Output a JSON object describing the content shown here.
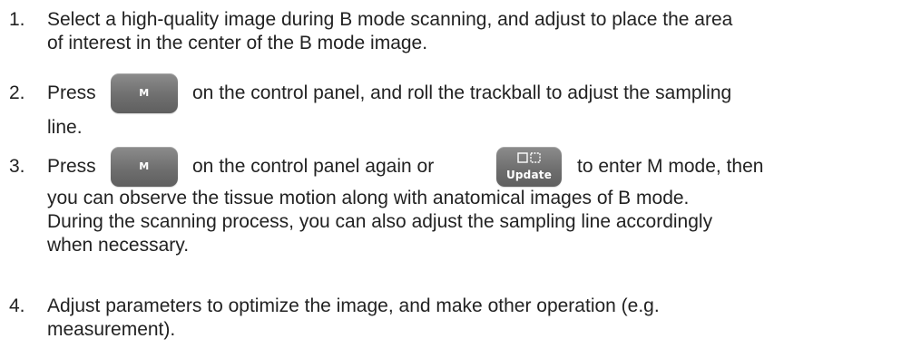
{
  "steps": [
    {
      "number": "1.",
      "lines": [
        "Select a high-quality image during B mode scanning, and adjust to place the area",
        "of interest in the center of the B mode image."
      ]
    },
    {
      "number": "2.",
      "segments": [
        "Press",
        "on the control panel, and roll the trackball to adjust the sampling"
      ],
      "continuation": "line."
    },
    {
      "number": "3.",
      "segments": [
        "Press",
        "on the control panel again or",
        "to enter M mode, then"
      ],
      "continuation_lines": [
        "you can observe the tissue motion along with anatomical images of B mode.",
        "During the scanning process, you can also adjust the sampling line accordingly",
        "when necessary."
      ]
    },
    {
      "number": "4.",
      "lines": [
        "Adjust parameters to optimize the image, and make other operation (e.g.",
        "measurement)."
      ]
    }
  ],
  "keys": {
    "m_key": {
      "label": "M",
      "icon": "m-key"
    },
    "update_key": {
      "label": "Update",
      "icon": "dual-window-icon"
    }
  },
  "colors": {
    "text": "#222222",
    "key_face": "#6f6f6f",
    "key_text": "#ffffff"
  }
}
